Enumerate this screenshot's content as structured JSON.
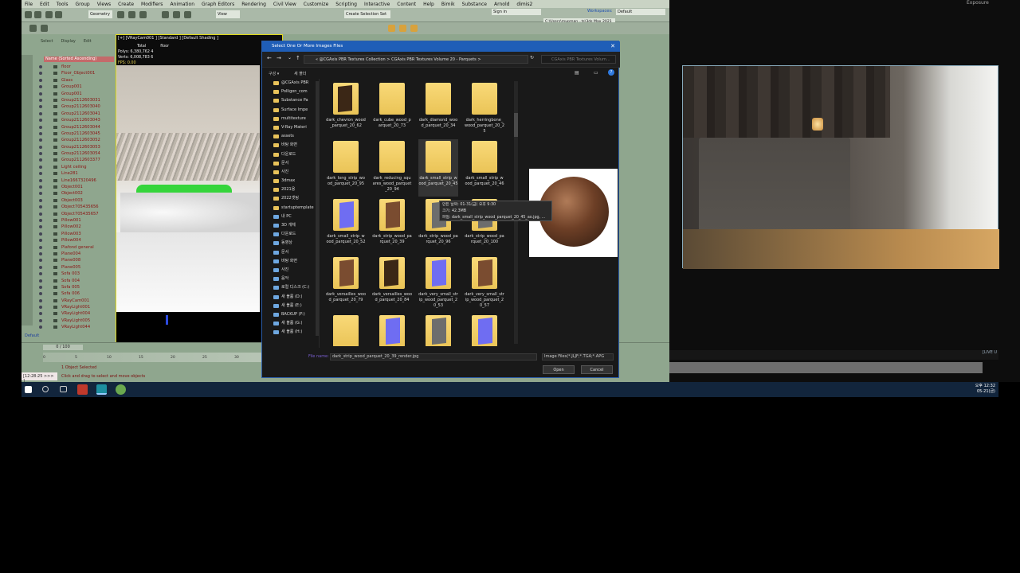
{
  "max": {
    "menu": [
      "File",
      "Edit",
      "Tools",
      "Group",
      "Views",
      "Create",
      "Modifiers",
      "Animation",
      "Graph Editors",
      "Rendering",
      "Civil View",
      "Customize",
      "Scripting",
      "Interactive",
      "Content",
      "Help",
      "Bimik",
      "Substance",
      "Arnold",
      "dimis2"
    ],
    "signin": "Sign in",
    "workspaces": "Workspaces:",
    "workspace_value": "Default",
    "path_field": "C:\\Users\\mupman...ts\\3ds Max 2021",
    "selection_set": "Create Selection Set",
    "view_dd": "View",
    "geometry_dd": "Geometry",
    "scene_tabs": [
      "Select",
      "Display",
      "Edit"
    ],
    "scene_header": "Name (Sorted Ascending)",
    "scene_items": [
      "floor",
      "Floor_Object001",
      "Glass",
      "Group001",
      "Group001",
      "Group2112603031",
      "Group2112603040",
      "Group2112603041",
      "Group2112603043",
      "Group2112603044",
      "Group2112603045",
      "Group2112603052",
      "Group2112603053",
      "Group2112603054",
      "Group2112603377",
      "Light ceiling",
      "Line281",
      "Line1667320496",
      "Object001",
      "Object002",
      "Object003",
      "Object705435656",
      "Object705435657",
      "Pillow001",
      "Pillow002",
      "Pillow003",
      "Pillow004",
      "Plafond general",
      "Plane004",
      "Plane008",
      "Plane005",
      "Sofa 003",
      "Sofa 004",
      "Sofa 005",
      "Sofa 006",
      "VRayCam001",
      "VRayLight001",
      "VRayLight004",
      "VRayLight005",
      "VRayLight044"
    ],
    "viewport_label": "[+] [VRayCam001 ] [Standard ] [Default Shading ]",
    "stats_head": [
      "Total",
      "floor"
    ],
    "stats": [
      "Polys:  6,380,762    4",
      "Verts:  6,008,783    6"
    ],
    "fps": "FPS:    0.00",
    "frame": "0 / 100",
    "default_label": "Default",
    "status_selected": "1 Object Selected",
    "status_hint": "Click and drag to select and move objects",
    "maxscript": "[12:28:25 >>> ]",
    "ruler_ticks": [
      "0",
      "5",
      "10",
      "15",
      "20",
      "25",
      "30",
      "35"
    ]
  },
  "dialog": {
    "title": "Select One Or More Images Files",
    "address": "« @CGAxis PBR Textures Collection  >  CGAxis PBR Textures Volume 20 - Parquets  >",
    "search_placeholder": "CGAxis PBR Textures Volum...",
    "organize": "구성 ▾",
    "new_folder": "새 폴더",
    "nav_items": [
      "@CGAxis PBR",
      "Polligon_com",
      "Substance Pa",
      "Surface Impe",
      "multitexture",
      "V-Ray Materi",
      "assets",
      "바탕 화면",
      "다운로드",
      "문서",
      "사진",
      "3dmax",
      "2021용",
      "2022셋팅",
      "startuptemplate"
    ],
    "nav_items2": [
      "내 PC",
      "3D 개체",
      "다운로드",
      "동영상",
      "문서",
      "바탕 화면",
      "사진",
      "음악",
      "로컬 디스크 (C:)",
      "새 볼륨 (D:)",
      "새 볼륨 (E:)",
      "BACKUP (F:)",
      "새 볼륨 (G:)",
      "새 볼륨 (H:)"
    ],
    "files": [
      {
        "name": "dark_chevron_wood_parquet_20_62",
        "style": "dark"
      },
      {
        "name": "dark_cube_wood_parquet_20_73",
        "style": "plain"
      },
      {
        "name": "dark_diamond_wood_parquet_20_34",
        "style": "plain"
      },
      {
        "name": "dark_herringbone_wood_parquet_20_25",
        "style": "plain"
      },
      {
        "name": "dark_long_strip_wood_parquet_20_95",
        "style": "plain"
      },
      {
        "name": "dark_reducing_squares_wood_parquet_20_94",
        "style": "plain"
      },
      {
        "name": "dark_small_strip_wood_parquet_20_45",
        "style": "plain"
      },
      {
        "name": "dark_small_strip_wood_parquet_20_46",
        "style": "plain"
      },
      {
        "name": "dark_small_strip_wood_parquet_20_52",
        "style": "blue"
      },
      {
        "name": "dark_strip_wood_parquet_20_39",
        "style": "brown"
      },
      {
        "name": "dark_strip_wood_parquet_20_96",
        "style": "grey"
      },
      {
        "name": "dark_strip_wood_parquet_20_100",
        "style": "grey"
      },
      {
        "name": "dark_versailles_wood_parquet_20_79",
        "style": "brown"
      },
      {
        "name": "dark_versailles_wood_parquet_20_84",
        "style": "dark"
      },
      {
        "name": "dark_very_small_strip_wood_parquet_20_53",
        "style": "blue"
      },
      {
        "name": "dark_very_small_strip_wood_parquet_20_57",
        "style": "brown"
      },
      {
        "name": "",
        "style": "plain"
      },
      {
        "name": "",
        "style": "blue"
      },
      {
        "name": "",
        "style": "grey"
      },
      {
        "name": "",
        "style": "blue"
      }
    ],
    "tooltip": [
      "만든 날짜: 01-31(금) 오후 9:30",
      "크기: 42.3MB",
      "파일: dark_small_strip_wood_parquet_20_45_ao.jpg, ..."
    ],
    "filename_label": "File name:",
    "filename_value": "dark_strip_wood_parquet_20_39_render.jpg",
    "filetype": "Image Files(*.JLJF;*.TGA;*.APG",
    "open": "Open",
    "cancel": "Cancel"
  },
  "vfb": {
    "exposure": "Exposure",
    "live": "[LIVE U"
  },
  "taskbar": {
    "time": "오후 12:32",
    "date": "05-21(금)"
  }
}
